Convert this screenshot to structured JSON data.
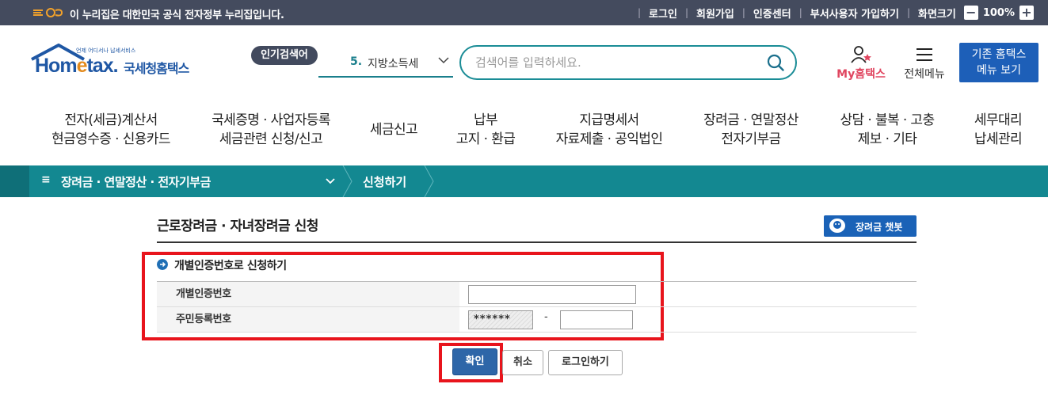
{
  "gov_banner": {
    "text": "이 누리집은 대한민국 공식 전자정부 누리집입니다.",
    "links": [
      "로그인",
      "회원가입",
      "인증센터",
      "부서사용자 가입하기",
      "화면크기"
    ],
    "zoom": "100%",
    "zoom_minus": "−",
    "zoom_plus": "+"
  },
  "header": {
    "logo_word_1": "Hom",
    "logo_word_e": "e",
    "logo_word_2": "tax.",
    "logo_kor": "국세청홈택스",
    "logo_small": "언제 어디서나 납세서비스",
    "popular_label": "인기검색어",
    "popular_rank": "5.",
    "popular_term": "지방소득세",
    "search_placeholder": "검색어를 입력하세요.",
    "myhome_label": "My홈택스",
    "menu_all_label": "전체메뉴",
    "old_home_line1": "기존 홈택스",
    "old_home_line2": "메뉴 보기"
  },
  "gnb": [
    {
      "l1": "전자(세금)계산서",
      "l2": "현금영수증 · 신용카드"
    },
    {
      "l1": "국세증명 · 사업자등록",
      "l2": "세금관련 신청/신고"
    },
    {
      "l1": "세금신고",
      "l2": ""
    },
    {
      "l1": "납부",
      "l2": "고지 · 환급"
    },
    {
      "l1": "지급명세서",
      "l2": "자료제출 · 공익법인"
    },
    {
      "l1": "장려금 · 연말정산",
      "l2": "전자기부금"
    },
    {
      "l1": "상담 · 불복 · 고충",
      "l2": "제보 · 기타"
    },
    {
      "l1": "세무대리",
      "l2": "납세관리"
    }
  ],
  "breadcrumb": {
    "menu_icon": "≡",
    "level1": "장려금 · 연말정산 · 전자기부금",
    "level2": "신청하기"
  },
  "content": {
    "page_title": "근로장려금 · 자녀장려금 신청",
    "chatbot_label": "장려금 챗봇",
    "section_title": "개별인증번호로 신청하기",
    "rows": [
      {
        "label": "개별인증번호"
      },
      {
        "label": "주민등록번호",
        "masked": "******",
        "dash": "-"
      }
    ],
    "buttons": {
      "confirm": "확인",
      "cancel": "취소",
      "login": "로그인하기"
    }
  },
  "colors": {
    "teal": "#138891",
    "gov_bar": "#444b5e",
    "brand_blue": "#1f57a4",
    "highlight": "#e8141c"
  }
}
